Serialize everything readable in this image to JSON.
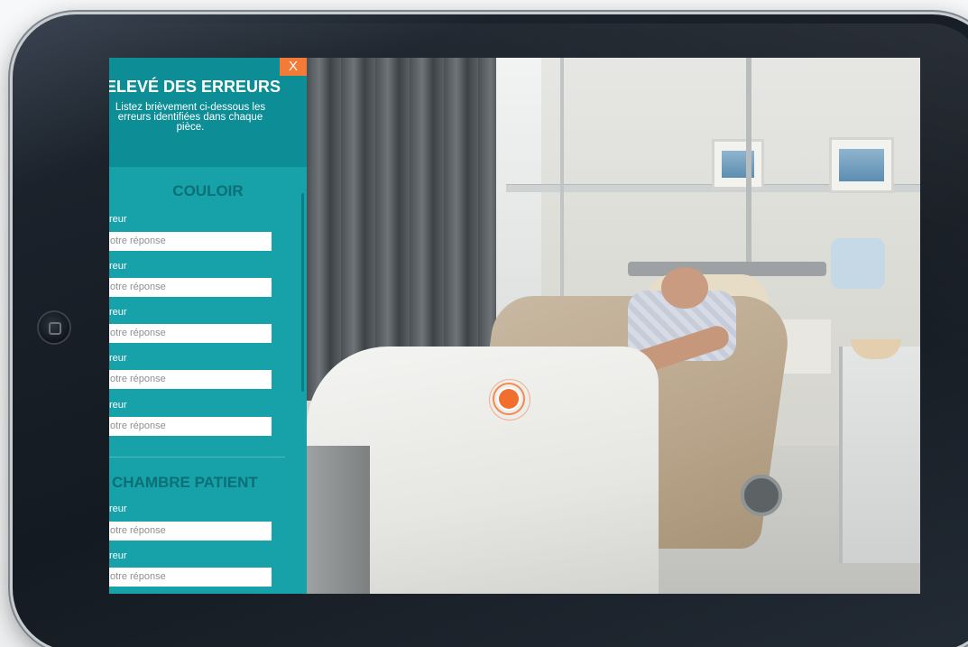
{
  "panel": {
    "close_label": "X",
    "title": "ELEVÉ DES ERREURS",
    "description": "Listez brièvement ci-dessous les erreurs identifiées dans chaque pièce.",
    "sections": [
      {
        "name": "COULOIR",
        "fields": [
          {
            "label": "reur",
            "placeholder": "otre réponse"
          },
          {
            "label": "reur",
            "placeholder": "otre réponse"
          },
          {
            "label": "reur",
            "placeholder": "otre réponse"
          },
          {
            "label": "reur",
            "placeholder": "otre réponse"
          },
          {
            "label": "reur",
            "placeholder": "otre réponse"
          }
        ]
      },
      {
        "name": "CHAMBRE PATIENT",
        "fields": [
          {
            "label": "reur",
            "placeholder": "otre réponse"
          },
          {
            "label": "reur",
            "placeholder": "otre réponse"
          }
        ]
      }
    ]
  },
  "scene": {
    "hotspot_color": "#f26e2f",
    "panel_color": "#17a1a9",
    "header_color": "#0d8e97",
    "accent": "#f47b37"
  }
}
